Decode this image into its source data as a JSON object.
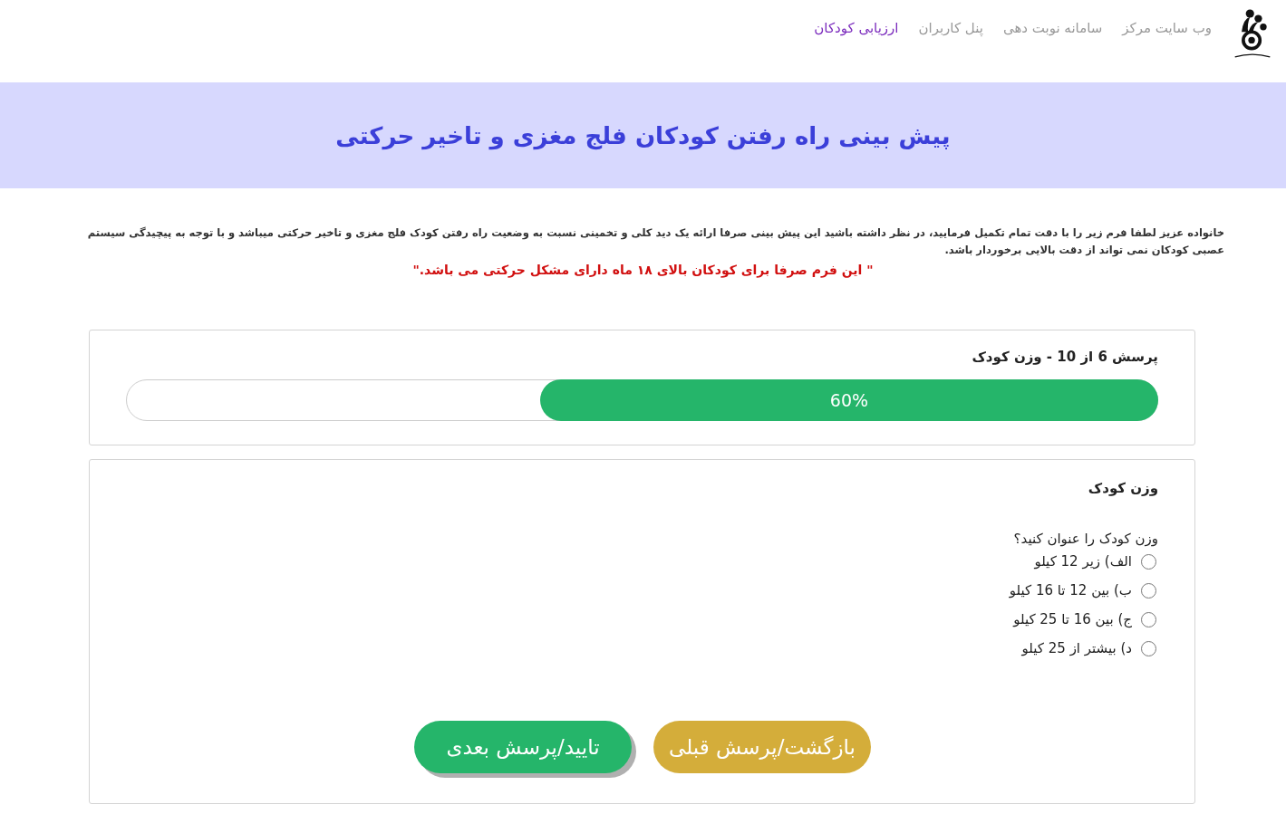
{
  "nav": {
    "items": [
      {
        "label": "وب سایت مرکز",
        "selected": false
      },
      {
        "label": "سامانه نوبت دهی",
        "selected": false
      },
      {
        "label": "پنل کاربران",
        "selected": false
      },
      {
        "label": "ارزیابی کودکان",
        "selected": true
      }
    ]
  },
  "banner": {
    "title": "پیش بینی راه رفتن کودکان فلج مغزی و تاخیر حرکتی"
  },
  "intro": {
    "text": "خانواده عزیز  لطفا فرم زیر را با دقت تمام  تکمیل فرمایید، در نظر داشته باشید این پیش بینی صرفا ارائه یک دید کلی  و تخمینی نسبت به وضعیت راه رفتن کودک فلج مغزی و تاخیر حرکتی میباشد و با توجه به پیچیدگی سیستم عصبی کودکان  نمی تواند از دقت بالایی برخوردار باشد.",
    "notice": "\" این فرم صرفا برای کودکان بالای ۱۸ ماه دارای مشکل حرکتی می باشد.\""
  },
  "progress": {
    "title": "پرسش 6 از 10 - وزن کودک",
    "level": 0.6,
    "label": "60%"
  },
  "question": {
    "heading": "وزن کودک",
    "prompt": "وزن کودک را عنوان کنید؟",
    "options": [
      {
        "label": "الف) زیر 12 کیلو",
        "selected": false
      },
      {
        "label": "ب) بین 12 تا 16 کیلو",
        "selected": false
      },
      {
        "label": "ج) بین 16 تا 25 کیلو",
        "selected": false
      },
      {
        "label": "د) بیشتر از 25 کیلو",
        "selected": false
      }
    ]
  },
  "buttons": [
    {
      "label": "بازگشت/پرسش قبلی",
      "kind": "back"
    },
    {
      "label": "تایید/پرسش بعدی",
      "kind": "next"
    }
  ]
}
